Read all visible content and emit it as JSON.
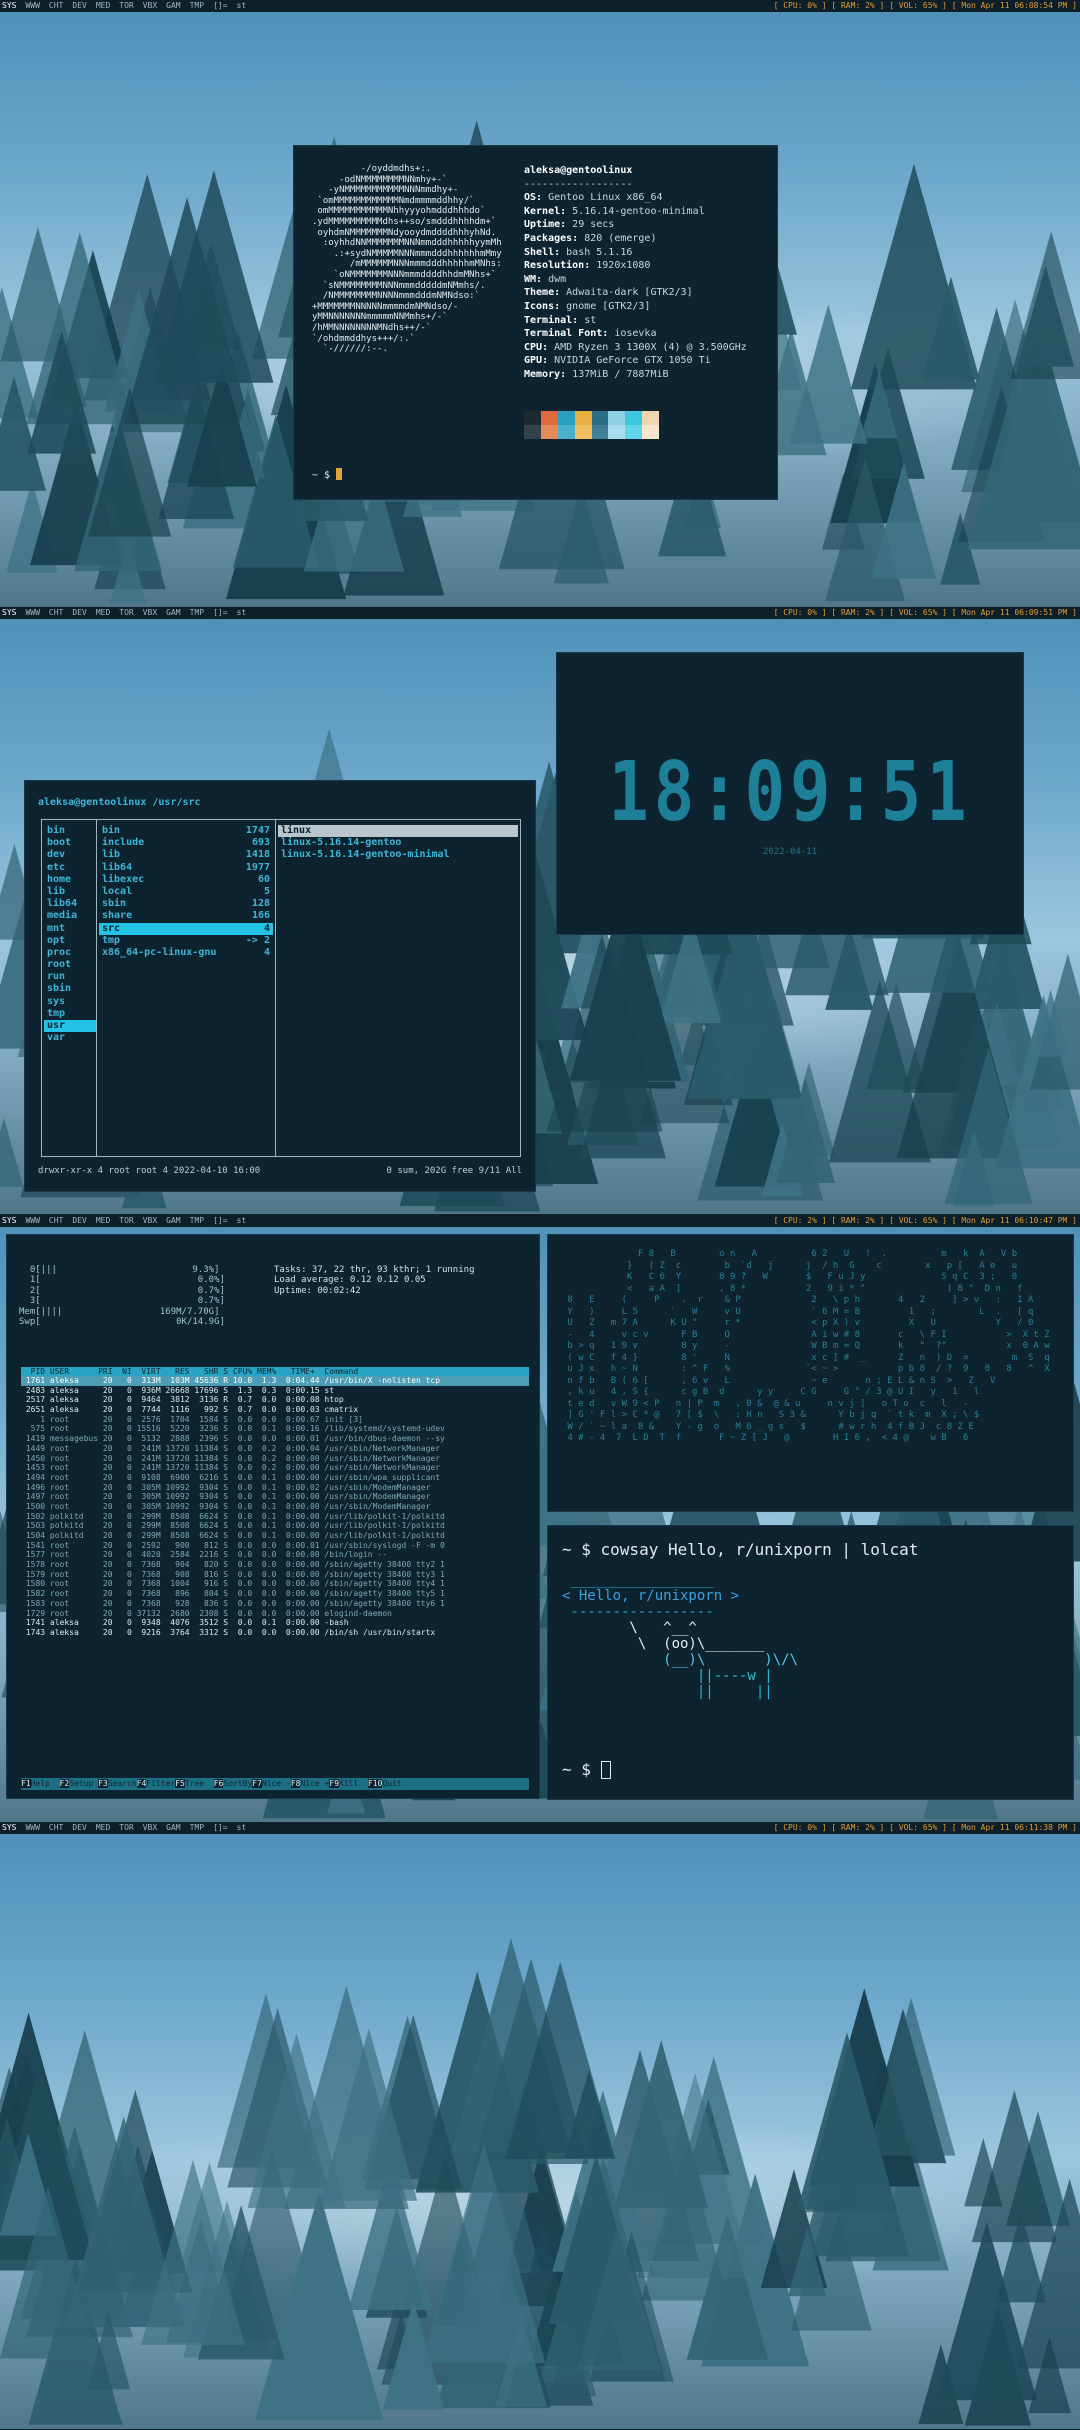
{
  "bars": [
    {
      "title": "st",
      "status": "[ CPU: 0% ] [ RAM: 2% ] [ VOL: 65% ] [ Mon Apr 11 06:08:54 PM ]"
    },
    {
      "title": "st",
      "status": "[ CPU: 0% ] [ RAM: 2% ] [ VOL: 65% ] [ Mon Apr 11 06:09:51 PM ]"
    },
    {
      "title": "st",
      "status": "[ CPU: 2% ] [ RAM: 2% ] [ VOL: 65% ] [ Mon Apr 11 06:10:47 PM ]"
    },
    {
      "title": "st",
      "status": "[ CPU: 0% ] [ RAM: 2% ] [ VOL: 65% ] [ Mon Apr 11 06:11:38 PM ]"
    }
  ],
  "tags": [
    "SYS",
    "WWW",
    "CHT",
    "DEV",
    "MED",
    "TOR",
    "VBX",
    "GAM",
    "TMP",
    "[]="
  ],
  "fetch": {
    "user": "aleksa@gentoolinux",
    "sep": "------------------",
    "fields": [
      {
        "k": "OS",
        "v": "Gentoo Linux x86_64"
      },
      {
        "k": "Kernel",
        "v": "5.16.14-gentoo-minimal"
      },
      {
        "k": "Uptime",
        "v": "29 secs"
      },
      {
        "k": "Packages",
        "v": "820 (emerge)"
      },
      {
        "k": "Shell",
        "v": "bash 5.1.16"
      },
      {
        "k": "Resolution",
        "v": "1920x1080"
      },
      {
        "k": "WM",
        "v": "dwm"
      },
      {
        "k": "Theme",
        "v": "Adwaita-dark [GTK2/3]"
      },
      {
        "k": "Icons",
        "v": "gnome [GTK2/3]"
      },
      {
        "k": "Terminal",
        "v": "st"
      },
      {
        "k": "Terminal Font",
        "v": "iosevka"
      },
      {
        "k": "CPU",
        "v": "AMD Ryzen 3 1300X (4) @ 3.500GHz"
      },
      {
        "k": "GPU",
        "v": "NVIDIA GeForce GTX 1050 Ti"
      },
      {
        "k": "Memory",
        "v": "137MiB / 7887MiB"
      }
    ],
    "palette": [
      "#1f2a30",
      "#e06a3a",
      "#2aa0c0",
      "#e8b040",
      "#2a6d86",
      "#8fd0e6",
      "#3fc6e0",
      "#f0d6b0",
      "#34424a",
      "#e68a5a",
      "#4ab0cc",
      "#f2c060",
      "#3e7e96",
      "#a8dcee",
      "#62d4ea",
      "#f6e6cc"
    ],
    "prompt": "~ $",
    "logo": [
      "         -/oyddmdhs+:.",
      "     -odNMMMMMMMMNNmhy+-`",
      "   -yNMMMMMMMMMMMNNNmmdhy+-",
      " `omMMMMMMMMMMMMNmdmmmmddhhy/`",
      " omMMMMMMMMMMMNhhyyyohmdddhhhdo`",
      ".ydMMMMMMMMMMdhs++so/smdddhhhhdm+`",
      " oyhdmNMMMMMMMNdyooydmddddhhhyhNd.",
      "  :oyhhdNNMMMMMMMNNNmmdddhhhhhyymMh",
      "    .:+sydNMMMMMNNNmmmdddhhhhhhmMmy",
      "       /mMMMMMMNNNmmmdddhhhhhmMNhs:",
      "    `oNMMMMMMMNNNmmmddddhhdmMNhs+`",
      "  `sNMMMMMMMMNNNmmmdddddmNMmhs/.",
      "  /NMMMMMMMMNNNNmmmdddmNMNdso:`",
      "+MMMMMMMNNNNNmmmmdmNMNdso/-",
      "yMMNNNNNNNmmmmmNNMmhs+/-`",
      "/hMMNNNNNNNNMNdhs++/-`",
      "`/ohdmmddhys+++/:.`",
      "  `-//////:--."
    ]
  },
  "clock": {
    "time": "18:09:51",
    "date": "2022-04-11"
  },
  "ranger": {
    "path": "aleksa@gentoolinux /usr/src",
    "col1": [
      "bin",
      "boot",
      "dev",
      "etc",
      "home",
      "lib",
      "lib64",
      "media",
      "mnt",
      "opt",
      "proc",
      "root",
      "run",
      "sbin",
      "sys",
      "tmp",
      "usr",
      "var"
    ],
    "col2": [
      {
        "n": "bin",
        "c": "1747"
      },
      {
        "n": "include",
        "c": "693"
      },
      {
        "n": "lib",
        "c": "1418"
      },
      {
        "n": "lib64",
        "c": "1977"
      },
      {
        "n": "libexec",
        "c": "60"
      },
      {
        "n": "local",
        "c": "5"
      },
      {
        "n": "sbin",
        "c": "128"
      },
      {
        "n": "share",
        "c": "166"
      },
      {
        "n": "src",
        "c": "4"
      },
      {
        "n": "tmp",
        "c": "-> 2"
      },
      {
        "n": "x86_64-pc-linux-gnu",
        "c": "4"
      }
    ],
    "col3": [
      "linux",
      "linux-5.16.14-gentoo",
      "linux-5.16.14-gentoo-minimal"
    ],
    "status_left": "drwxr-xr-x 4 root root 4 2022-04-10 16:00",
    "status_right": "0 sum, 202G free  9/11  All"
  },
  "htop": {
    "meters": [
      "  0[|||                         9.3%]",
      "  1[                             0.0%]",
      "  2[                             0.7%]",
      "  3[                             0.7%]",
      "Mem[||||                  169M/7.70G]",
      "Swp[                         0K/14.9G]"
    ],
    "stats": [
      "Tasks: 37, 22 thr, 93 kthr; 1 running",
      "Load average: 0.12 0.12 0.05",
      "Uptime: 00:02:42"
    ],
    "header": "  PID USER      PRI  NI  VIRT   RES   SHR S CPU% MEM%   TIME+  Command",
    "rows": [
      " 1761 aleksa     20   0  313M  103M 45636 R 10.0  1.3  0:04.44 /usr/bin/X -nolisten tcp",
      " 2483 aleksa     20   0  936M 26668 17696 S  1.3  0.3  0:00.15 st",
      " 2517 aleksa     20   0  9464  3812  3136 R  0.7  0.0  0:00.08 htop",
      " 2651 aleksa     20   0  7744  1116   992 S  0.7  0.0  0:00.03 cmatrix",
      "    1 root       20   0  2576  1704  1584 S  0.0  0.0  0:00.67 init [3]",
      "  575 root       20   0 15516  5220  3236 S  0.0  0.1  0:00.16 /lib/systemd/systemd-udev",
      " 1419 messagebus 20   0  5132  2888  2396 S  0.0  0.0  0:00.01 /usr/bin/dbus-daemon --sy",
      " 1449 root       20   0  241M 13720 11384 S  0.0  0.2  0:00.04 /usr/sbin/NetworkManager",
      " 1450 root       20   0  241M 13720 11384 S  0.0  0.2  0:00.00 /usr/sbin/NetworkManager",
      " 1453 root       20   0  241M 13720 11384 S  0.0  0.2  0:00.00 /usr/sbin/NetworkManager",
      " 1494 root       20   0  9108  6900  6216 S  0.0  0.1  0:00.00 /usr/sbin/wpa_supplicant",
      " 1496 root       20   0  305M 10992  9304 S  0.0  0.1  0:00.02 /usr/sbin/ModemManager",
      " 1497 root       20   0  305M 10992  9304 S  0.0  0.1  0:00.00 /usr/sbin/ModemManager",
      " 1500 root       20   0  305M 10992  9304 S  0.0  0.1  0:00.00 /usr/sbin/ModemManager",
      " 1502 polkitd    20   0  299M  8508  6624 S  0.0  0.1  0:00.00 /usr/lib/polkit-1/polkitd",
      " 1503 polkitd    20   0  299M  8508  6624 S  0.0  0.1  0:00.00 /usr/lib/polkit-1/polkitd",
      " 1504 polkitd    20   0  299M  8508  6624 S  0.0  0.1  0:00.00 /usr/lib/polkit-1/polkitd",
      " 1541 root       20   0  2592   900   812 S  0.0  0.0  0:00.01 /usr/sbin/syslogd -F -m 0",
      " 1577 root       20   0  4020  2584  2216 S  0.0  0.0  0:00.00 /bin/login --",
      " 1578 root       20   0  7368   904   820 S  0.0  0.0  0:00.00 /sbin/agetty 38400 tty2 1",
      " 1579 root       20   0  7368   908   816 S  0.0  0.0  0:00.00 /sbin/agetty 38400 tty3 1",
      " 1580 root       20   0  7368  1004   916 S  0.0  0.0  0:00.00 /sbin/agetty 38400 tty4 1",
      " 1582 root       20   0  7368   896   804 S  0.0  0.0  0:00.00 /sbin/agetty 38400 tty5 1",
      " 1583 root       20   0  7368   928   836 S  0.0  0.0  0:00.00 /sbin/agetty 38400 tty6 1",
      " 1729 root       20   0 37132  2680  2308 S  0.0  0.0  0:00.00 elogind-daemon",
      " 1741 aleksa     20   0  9348  4076  3512 S  0.0  0.1  0:00.00 -bash",
      " 1743 aleksa     20   0  9216  3764  3312 S  0.0  0.0  0:00.00 /bin/sh /usr/bin/startx"
    ],
    "fkeys": [
      {
        "k": "F1",
        "l": "Help  "
      },
      {
        "k": "F2",
        "l": "Setup "
      },
      {
        "k": "F3",
        "l": "Search"
      },
      {
        "k": "F4",
        "l": "Filter"
      },
      {
        "k": "F5",
        "l": "Tree  "
      },
      {
        "k": "F6",
        "l": "SortBy"
      },
      {
        "k": "F7",
        "l": "Nice -"
      },
      {
        "k": "F8",
        "l": "Nice +"
      },
      {
        "k": "F9",
        "l": "Kill  "
      },
      {
        "k": "F10",
        "l": "Quit"
      }
    ]
  },
  "matrix": {
    "lines": [
      "              F 8   B        o n   A          6 2   U   !  .          m   k  A   V b",
      "            }   ( Z  c        b  `d   j      j  / h  G    c        x   p [   A e   u",
      "            K   C 6  Y       8 9 ?   W       $   F u J y              S q C  3 ;   0",
      "            <   a A  ]       , 8 *           2   9 i * \"               ) 8 \"  D n   f",
      " 8   E     (     P    .  r    & P             2   \\ p h       4   2     ] > v   :   1 A",
      " Y   )     L 5      `   W     v U             ` 6 M = B         1   ;        L  .   [ q",
      " U   Z   m 7 A      K U \"     r *             < p X ) v         X   U           Y   / 0",
      " -   4     v c v      F B     Q               A i w # 8       c   \\ F I           >  X t Z",
      " b > q   1 9 v        8 y     -               W B m = Q       k   \"  ?\"           x  0 A w",
      " ( w C   f 4 }        8 '     N               x c ] #  _      Z   n  ) D  =        m  S  q",
      " u J x   h ~ N        : ^ F   %              `< ~ >           p b 8  / ?  9   0   8   ^  X",
      " n f b   B ( 6 [      , 6 v   L               ~ e       n ; E L & n S  >   Z   V",
      " , k u   4 , S {      c g B  d      y y     C G     G \" / 3 @ U I   y   1   l",
      " t e d   v W 9 < P   n | P  m   , 0 &  @ & u     n v j ]   o T o  c   l   -",
      " ] G ' F l > C * @   7 [ $  \\   : H n   S 3 &      Y b j q  ` t k  m  X ; \\ $",
      " W / ` ~ l a  8 &    Y - g  o   M 6 _ g s   $      # w r h  4 f B J  c 8 Z E",
      " 4 # - 4  7  L D  T  f       F ~ Z [ J   @        H I 6 ,  < 4 @    w B   6"
    ]
  },
  "cowsay": {
    "cmd": "~ $ cowsay Hello, r/unixporn | lolcat",
    "art": [
      " _________________",
      "< Hello, r/unixporn >",
      " -----------------",
      "        \\   ^__^",
      "         \\  (oo)\\_______",
      "            (__)\\       )\\/\\",
      "                ||----w |",
      "                ||     ||"
    ],
    "prompt": "~ $ "
  }
}
